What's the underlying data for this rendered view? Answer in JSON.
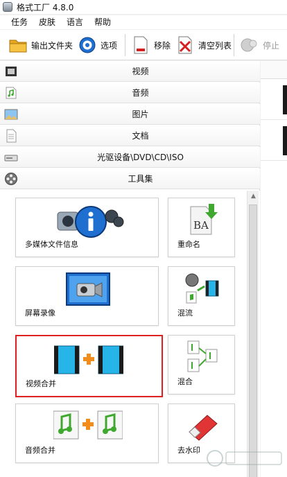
{
  "window": {
    "title": "格式工厂 4.8.0"
  },
  "menu": [
    "任务",
    "皮肤",
    "语言",
    "帮助"
  ],
  "toolbar": {
    "output_folder": "输出文件夹",
    "options": "选项",
    "remove": "移除",
    "clear_list": "清空列表",
    "stop": "停止"
  },
  "categories": [
    {
      "label": "视频",
      "icon": "film-icon"
    },
    {
      "label": "音频",
      "icon": "music-note-icon"
    },
    {
      "label": "图片",
      "icon": "picture-icon"
    },
    {
      "label": "文档",
      "icon": "document-icon"
    },
    {
      "label": "光驱设备\\DVD\\CD\\ISO",
      "icon": "disc-drive-icon"
    },
    {
      "label": "工具集",
      "icon": "film-reel-icon"
    }
  ],
  "tools": [
    {
      "label": "多媒体文件信息",
      "icon": "media-info-icon"
    },
    {
      "label": "重命名",
      "icon": "rename-icon"
    },
    {
      "label": "屏幕录像",
      "icon": "screen-record-icon"
    },
    {
      "label": "混流",
      "icon": "mux-icon"
    },
    {
      "label": "视频合并",
      "icon": "video-join-icon"
    },
    {
      "label": "混合",
      "icon": "audio-mix-icon"
    },
    {
      "label": "音频合并",
      "icon": "audio-join-icon"
    },
    {
      "label": "去水印",
      "icon": "eraser-icon"
    }
  ],
  "selected_tool": "视频合并",
  "colors": {
    "selection": "#e02020",
    "accent_blue": "#1f6fd1",
    "accent_orange": "#f28c1b",
    "film_cyan": "#27b4e8",
    "music_green": "#3fa82e"
  }
}
